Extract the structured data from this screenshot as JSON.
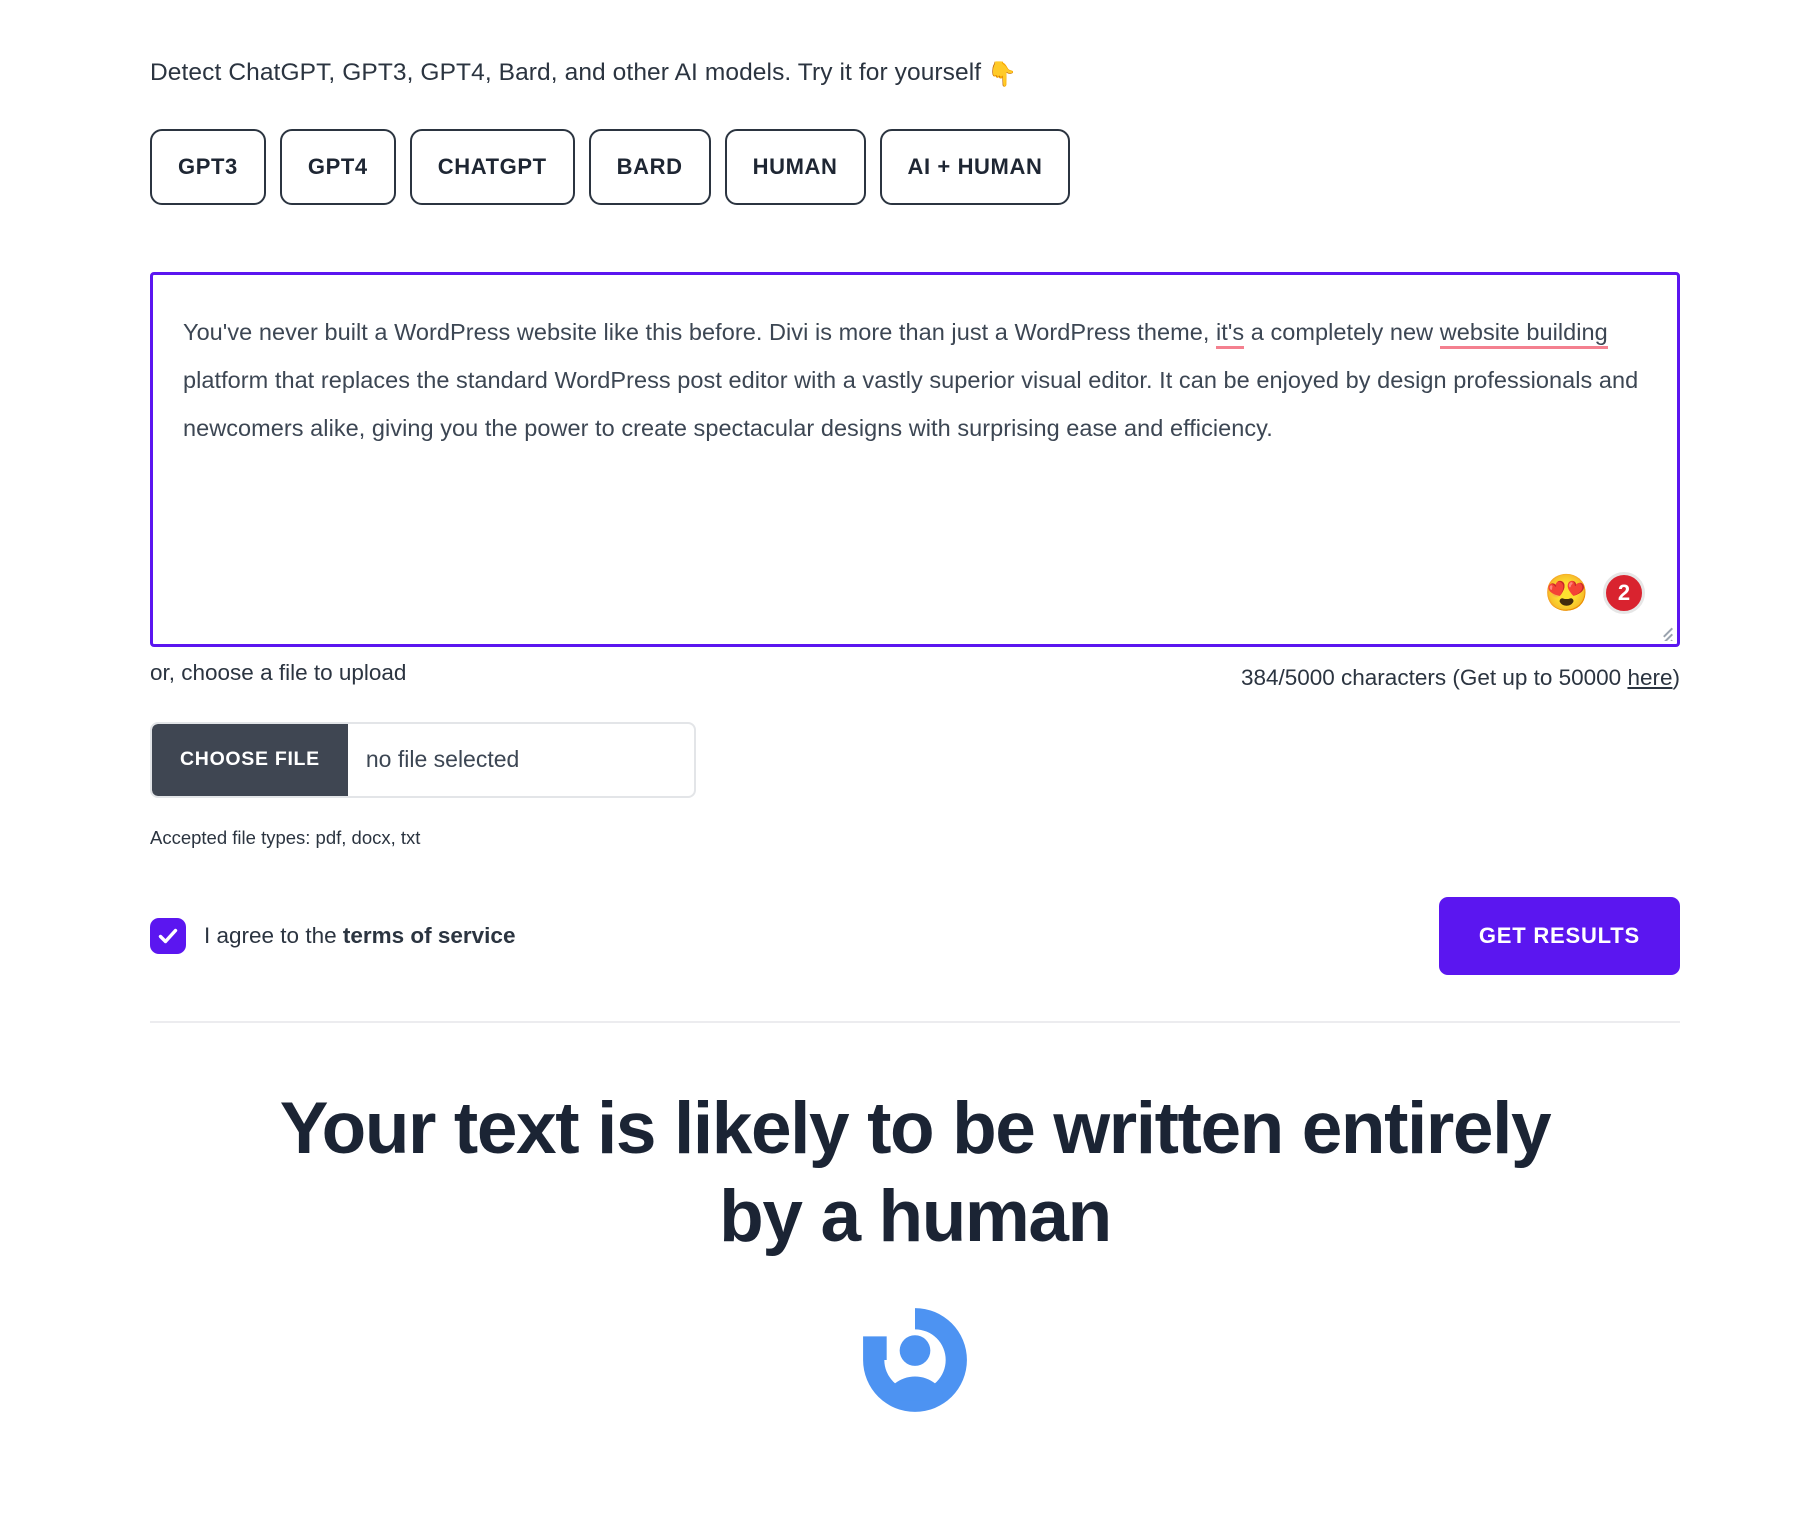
{
  "intro": {
    "text": "Detect ChatGPT, GPT3, GPT4, Bard, and other AI models. Try it for yourself",
    "emoji": "👇"
  },
  "tabs": [
    {
      "label": "GPT3"
    },
    {
      "label": "GPT4"
    },
    {
      "label": "CHATGPT"
    },
    {
      "label": "BARD"
    },
    {
      "label": "HUMAN"
    },
    {
      "label": "AI + HUMAN"
    }
  ],
  "editor": {
    "segment_1": "You've never built a WordPress website like this before. Divi is more than just a WordPress theme, ",
    "error_1": "it's",
    "segment_2": " a completely new ",
    "error_2": "website building",
    "segment_3": " platform that replaces the standard WordPress post editor with a vastly superior visual editor. It can be enjoyed by design professionals and newcomers alike, giving you the power to create spectacular designs with surprising ease and efficiency.",
    "full_text": "You've never built a WordPress website like this before. Divi is more than just a WordPress theme, it's a completely new website building platform that replaces the standard WordPress post editor with a vastly superior visual editor. It can be enjoyed by design professionals and newcomers alike, giving you the power to create spectacular designs with surprising ease and efficiency.",
    "assistant_emoji": "😍",
    "suggestion_count": "2",
    "border_color": "#5b16f0",
    "error_underline_color": "#f4808f"
  },
  "counter": {
    "used": "384",
    "limit": "5000",
    "text_before": "384/5000 characters (Get up to 50000 ",
    "link_label": "here",
    "text_after": ")"
  },
  "upload": {
    "label": "or, choose a file to upload",
    "button_label": "CHOOSE FILE",
    "file_name": "no file selected",
    "accepted": "Accepted file types: pdf, docx, txt"
  },
  "agree": {
    "checked": true,
    "check_glyph": "✓",
    "text_before": "I agree to the ",
    "terms_label": "terms of service",
    "submit_label": "GET RESULTS"
  },
  "result": {
    "line_1": "Your text is likely to be written entirely",
    "line_2": "by a human",
    "icon_name": "human-result-icon",
    "icon_color": "#4d93f2",
    "heading_color": "#1b2434"
  }
}
